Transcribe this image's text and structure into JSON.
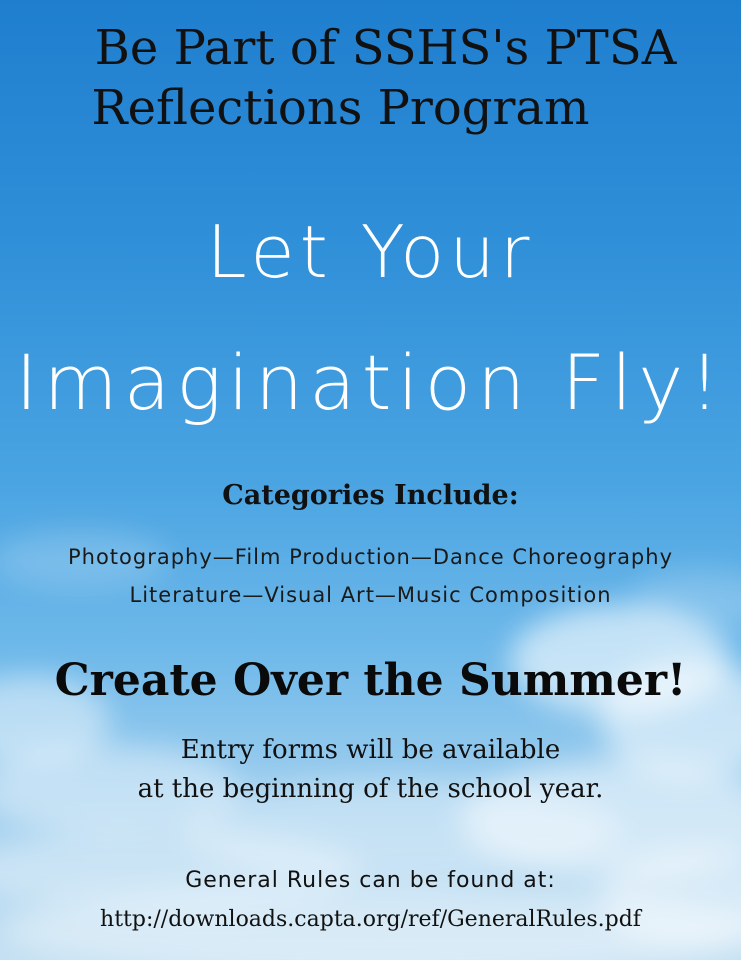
{
  "title": {
    "line1": "Be Part of SSHS's PTSA",
    "line2": "Reflections Program"
  },
  "slogan": {
    "line1": "Let Your",
    "line2": "Imagination Fly!"
  },
  "categories": {
    "heading": "Categories Include:",
    "line1": "Photography—Film Production—Dance Choreography",
    "line2": "Literature—Visual Art—Music Composition"
  },
  "summer": {
    "headline": "Create Over the Summer!",
    "line1": "Entry forms will be available",
    "line2": "at the beginning of the school year."
  },
  "rules": {
    "heading": "General Rules can be found at:",
    "url": "http://downloads.capta.org/ref/GeneralRules.pdf"
  },
  "colors": {
    "sky_top": "#1f7fcf",
    "sky_bottom": "#c4e0f2",
    "slogan_text": "#ffffff",
    "body_text": "#111111"
  }
}
